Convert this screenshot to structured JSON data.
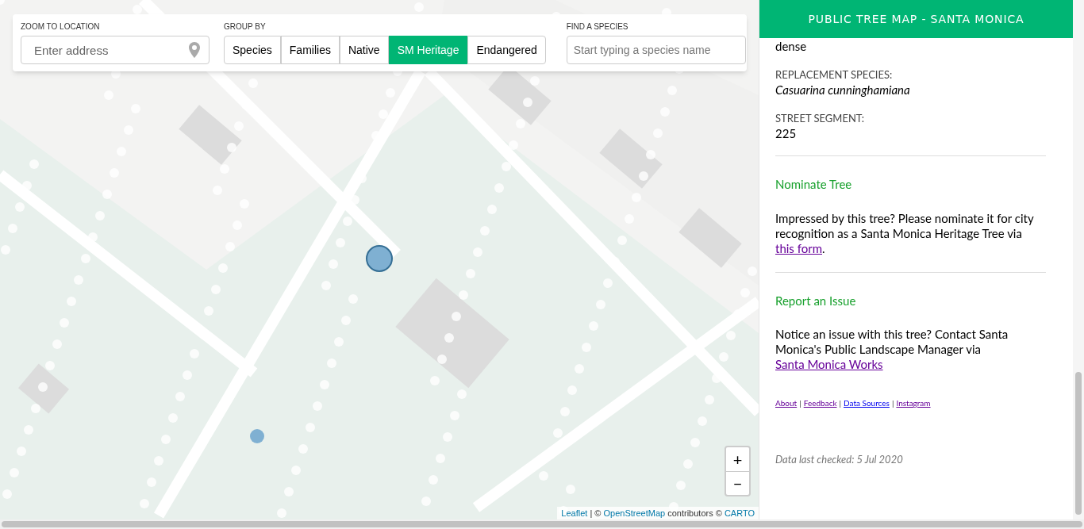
{
  "controls": {
    "location": {
      "label": "ZOOM TO LOCATION",
      "placeholder": "Enter address"
    },
    "group_by": {
      "label": "GROUP BY",
      "options": [
        {
          "label": "Species",
          "selected": false
        },
        {
          "label": "Families",
          "selected": false
        },
        {
          "label": "Native",
          "selected": false
        },
        {
          "label": "SM Heritage",
          "selected": true
        },
        {
          "label": "Endangered",
          "selected": false
        }
      ]
    },
    "species": {
      "label": "FIND A SPECIES",
      "placeholder": "Start typing a species name"
    }
  },
  "map": {
    "markers": [
      {
        "selected": true
      },
      {
        "selected": false
      }
    ],
    "zoom_buttons": [
      "+",
      "−"
    ],
    "attribution": {
      "links": [
        "Leaflet",
        "OpenStreetMap",
        "CARTO"
      ],
      "separator": "|",
      "copy1": "©",
      "middle": "contributors ©"
    }
  },
  "panel": {
    "title": "PUBLIC TREE MAP - SANTA MONICA",
    "fields": [
      {
        "value": "dense",
        "italic": false
      },
      {
        "label": "REPLACEMENT SPECIES:",
        "value": "Casuarina cunninghamiana",
        "italic": true
      },
      {
        "label": "STREET SEGMENT:",
        "value": "225",
        "italic": false
      }
    ],
    "sections": [
      {
        "heading": "Nominate Tree",
        "before": "Impressed by this tree? Please nominate it for city recognition as a Santa Monica Heritage Tree via ",
        "link": "this form",
        "after": "."
      },
      {
        "heading": "Report an Issue",
        "before": "Notice an issue with this tree? Contact Santa Monica's Public Landscape Manager via ",
        "link": "Santa Monica Works"
      }
    ],
    "footer_links": [
      {
        "label": "About",
        "visited": true
      },
      {
        "label": "Feedback",
        "visited": true
      },
      {
        "label": "Data Sources",
        "visited": false
      },
      {
        "label": "Instagram",
        "visited": true
      }
    ],
    "footer_separator": "|",
    "last_checked": "Data last checked: 5 Jul 2020"
  }
}
